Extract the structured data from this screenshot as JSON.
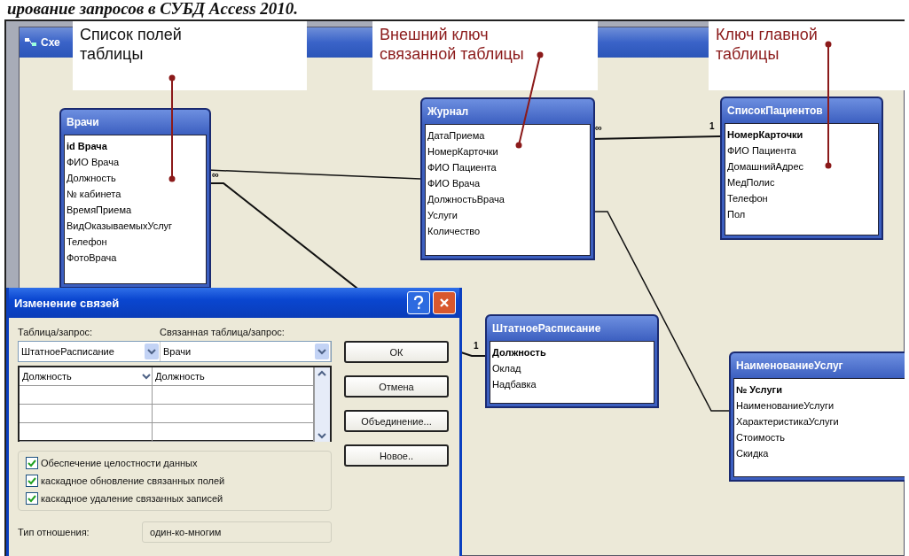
{
  "caption": "ирование запросов в СУБД Access 2010.",
  "window": {
    "title": "Схе"
  },
  "annotations": [
    {
      "text": "Список полей таблицы",
      "color": "#111111"
    },
    {
      "text": "Внешний ключ связанной таблицы",
      "color": "#8b1a1a"
    },
    {
      "text": "Ключ главной таблицы",
      "color": "#8b1a1a"
    }
  ],
  "tables": [
    {
      "name": "Врачи",
      "fields": [
        {
          "name": "id Врача",
          "key": true
        },
        {
          "name": "ФИО Врача",
          "key": false
        },
        {
          "name": "Должность",
          "key": false
        },
        {
          "name": "№ кабинета",
          "key": false
        },
        {
          "name": "ВремяПриема",
          "key": false
        },
        {
          "name": "ВидОказываемыхУслуг",
          "key": false
        },
        {
          "name": "Телефон",
          "key": false
        },
        {
          "name": "ФотоВрача",
          "key": false
        }
      ]
    },
    {
      "name": "Журнал",
      "fields": [
        {
          "name": "ДатаПриема",
          "key": false
        },
        {
          "name": "НомерКарточки",
          "key": false
        },
        {
          "name": "ФИО Пациента",
          "key": false
        },
        {
          "name": "ФИО Врача",
          "key": false
        },
        {
          "name": "ДолжностьВрача",
          "key": false
        },
        {
          "name": "Услуги",
          "key": false
        },
        {
          "name": "Количество",
          "key": false
        }
      ]
    },
    {
      "name": "СписокПациентов",
      "fields": [
        {
          "name": "НомерКарточки",
          "key": true
        },
        {
          "name": "ФИО Пациента",
          "key": false
        },
        {
          "name": "ДомашнийАдрес",
          "key": false
        },
        {
          "name": "МедПолис",
          "key": false
        },
        {
          "name": "Телефон",
          "key": false
        },
        {
          "name": "Пол",
          "key": false
        }
      ]
    },
    {
      "name": "ШтатноеРасписание",
      "fields": [
        {
          "name": "Должность",
          "key": true
        },
        {
          "name": "Оклад",
          "key": false
        },
        {
          "name": "Надбавка",
          "key": false
        }
      ]
    },
    {
      "name": "НаименованиеУслуг",
      "fields": [
        {
          "name": "№ Услуги",
          "key": true
        },
        {
          "name": "НаименованиеУслуги",
          "key": false
        },
        {
          "name": "ХарактеристикаУслуги",
          "key": false
        },
        {
          "name": "Стоимость",
          "key": false
        },
        {
          "name": "Скидка",
          "key": false
        }
      ]
    }
  ],
  "relationships": [
    {
      "kind": "plain"
    },
    {
      "kind": "labeled",
      "start_label": "∞",
      "end_label": "1"
    },
    {
      "kind": "labeled",
      "start_label": "∞",
      "end_label": "1"
    },
    {
      "kind": "plain"
    }
  ],
  "dialog": {
    "title": "Изменение связей",
    "table_label": "Таблица/запрос:",
    "related_label": "Связанная таблица/запрос:",
    "table_value": "ШтатноеРасписание",
    "related_value": "Врачи",
    "field_rows": [
      {
        "left": "Должность",
        "right": "Должность"
      }
    ],
    "options": [
      {
        "label": "Обеспечение целостности данных",
        "checked": true
      },
      {
        "label": "каскадное обновление связанных полей",
        "checked": true
      },
      {
        "label": "каскадное удаление связанных записей",
        "checked": true
      }
    ],
    "buttons": [
      "ОК",
      "Отмена",
      "Объединение...",
      "Новое.."
    ],
    "relation_type_label": "Тип отношения:",
    "relation_type": "один-ко-многим"
  }
}
